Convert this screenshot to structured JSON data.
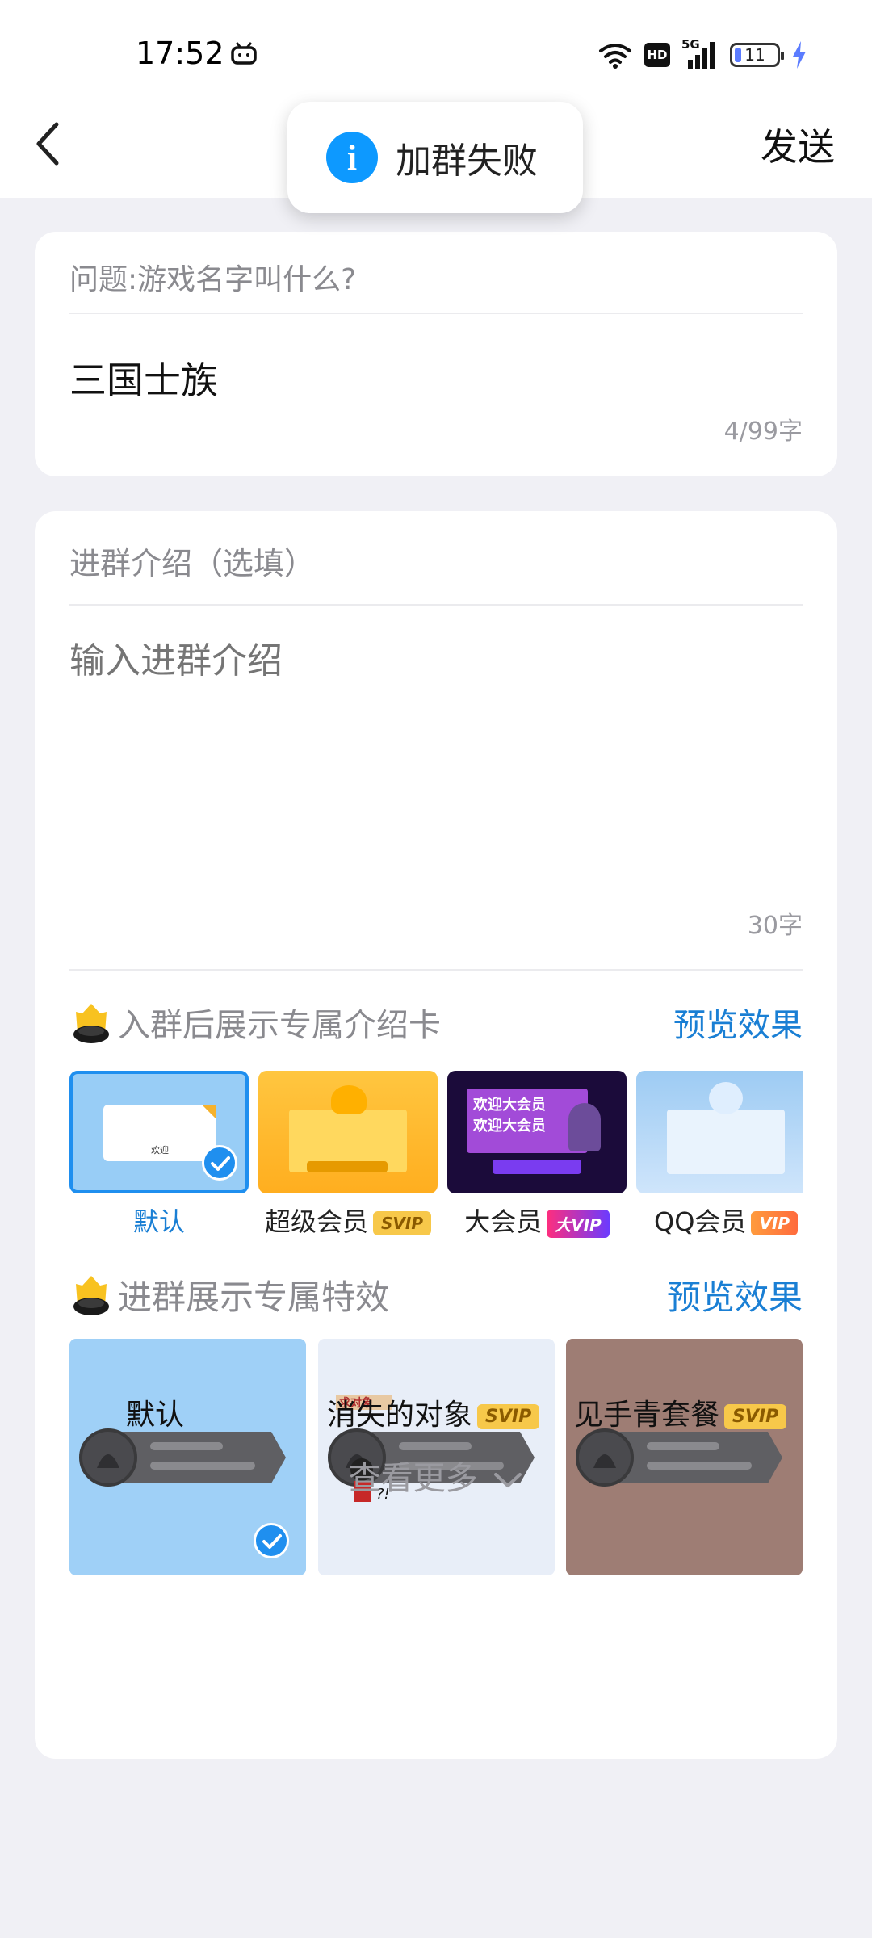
{
  "status_bar": {
    "time": "17:52",
    "network": "5G",
    "hd": "HD",
    "battery": "11"
  },
  "nav": {
    "send_label": "发送"
  },
  "toast": {
    "message": "加群失败"
  },
  "question": {
    "label": "问题:游戏名字叫什么?",
    "answer": "三国士族",
    "count": "4/99字"
  },
  "intro": {
    "label": "进群介绍（选填）",
    "placeholder": "输入进群介绍",
    "count": "30字"
  },
  "intro_cards": {
    "title": "入群后展示专属介绍卡",
    "preview_label": "预览效果",
    "items": [
      {
        "label": "默认",
        "badge": "",
        "selected": true
      },
      {
        "label": "超级会员",
        "badge": "SVIP"
      },
      {
        "label": "大会员",
        "badge": "大VIP"
      },
      {
        "label": "QQ会员",
        "badge": "VIP"
      }
    ],
    "tile_text": "欢迎",
    "banner_text": "欢迎大会员"
  },
  "effects": {
    "title": "进群展示专属特效",
    "preview_label": "预览效果",
    "items": [
      {
        "label": "默认",
        "badge": "",
        "selected": true
      },
      {
        "label": "消失的对象",
        "badge": "SVIP"
      },
      {
        "label": "见手青套餐",
        "badge": "SVIP"
      }
    ],
    "sign_text": "求对象",
    "bubble_text": "?!"
  },
  "more_label": "查看更多",
  "colors": {
    "accent": "#1a7fd4",
    "check": "#1f8fef",
    "info": "#0d99ff",
    "background": "#f0f0f5"
  }
}
